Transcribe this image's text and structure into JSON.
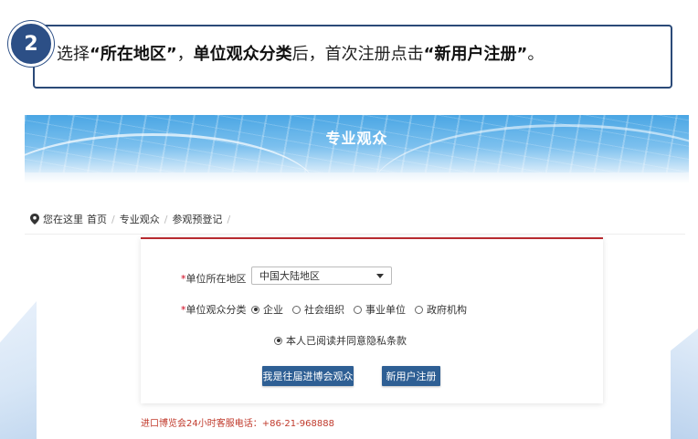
{
  "step": {
    "number": "2",
    "parts": [
      {
        "text": "选择",
        "bold": false
      },
      {
        "text": "“所在地区”",
        "bold": true
      },
      {
        "text": "，",
        "bold": false
      },
      {
        "text": "单位观众分类",
        "bold": true
      },
      {
        "text": "后，首次注册点击",
        "bold": false
      },
      {
        "text": "“新用户注册”",
        "bold": true
      },
      {
        "text": "。",
        "bold": false
      }
    ]
  },
  "hero": {
    "title": "专业观众"
  },
  "breadcrumb": {
    "prefix": "您在这里",
    "items": [
      "首页",
      "专业观众",
      "参观预登记"
    ]
  },
  "form": {
    "region_label": "单位所在地区",
    "region_value": "中国大陆地区",
    "category_label": "单位观众分类",
    "category_options": [
      {
        "label": "企业",
        "selected": true
      },
      {
        "label": "社会组织",
        "selected": false
      },
      {
        "label": "事业单位",
        "selected": false
      },
      {
        "label": "政府机构",
        "selected": false
      }
    ],
    "agree_label": "本人已阅读并同意隐私条款",
    "agree_checked": true,
    "past_visitor_button": "我是往届进博会观众",
    "new_user_button": "新用户注册",
    "required_mark": "*"
  },
  "hotline": "进口博览会24小时客服电话：+86-21-968888",
  "colors": {
    "brand_blue": "#2e5f94",
    "badge_blue": "#2c4f86",
    "accent_red": "#b72b30",
    "hotline_red": "#c0392b"
  }
}
